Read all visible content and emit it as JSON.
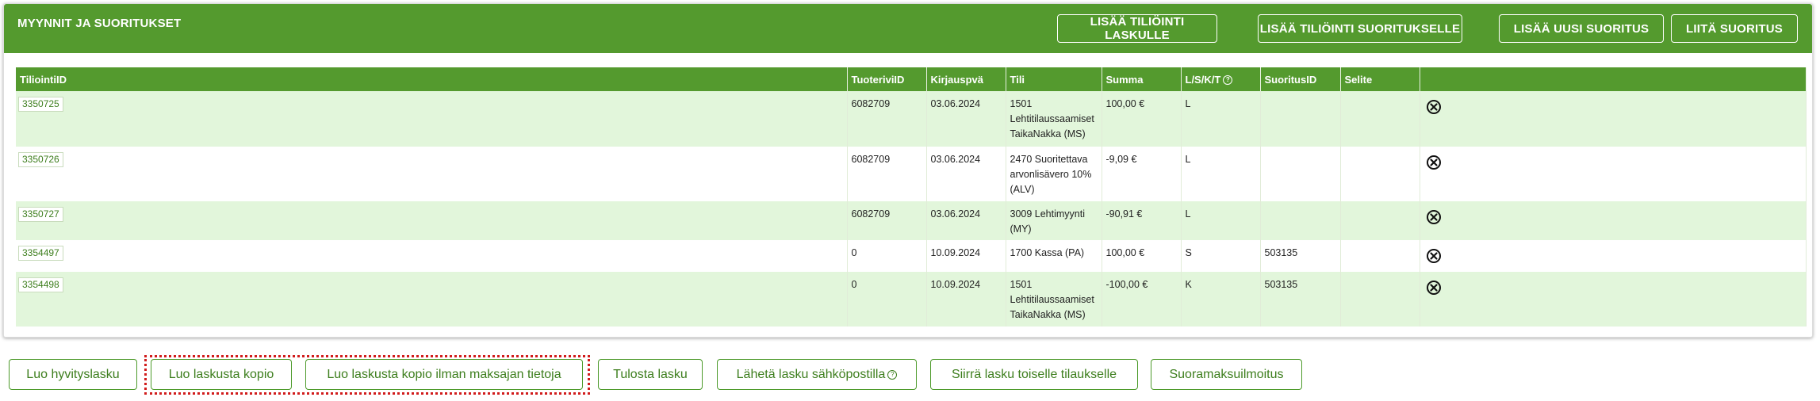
{
  "panel": {
    "title": "MYYNNIT JA SUORITUKSET",
    "buttons": [
      {
        "label": "LISÄÄ TILIÖINTI LASKULLE"
      },
      {
        "label": "LISÄÄ TILIÖINTI SUORITUKSELLE"
      },
      {
        "label": "LISÄÄ UUSI SUORITUS"
      },
      {
        "label": "LIITÄ SUORITUS"
      }
    ]
  },
  "table": {
    "columns": [
      "TiliointiID",
      "TuoteriviID",
      "Kirjauspvä",
      "Tili",
      "Summa",
      "L/S/K/T",
      "SuoritusID",
      "Selite",
      ""
    ],
    "rows": [
      {
        "id": "3350725",
        "tuoterivi": "6082709",
        "pvm": "03.06.2024",
        "tili": [
          "1501",
          "Lehtitilaussaamiset",
          "TaikaNakka (MS)"
        ],
        "summa": "100,00 €",
        "lskt": "L",
        "suoritus": "",
        "selite": ""
      },
      {
        "id": "3350726",
        "tuoterivi": "6082709",
        "pvm": "03.06.2024",
        "tili": [
          "2470 Suoritettava",
          "arvonlisävero 10%",
          "(ALV)"
        ],
        "summa": "-9,09 €",
        "lskt": "L",
        "suoritus": "",
        "selite": ""
      },
      {
        "id": "3350727",
        "tuoterivi": "6082709",
        "pvm": "03.06.2024",
        "tili": [
          "3009 Lehtimyynti",
          "(MY)"
        ],
        "summa": "-90,91 €",
        "lskt": "L",
        "suoritus": "",
        "selite": ""
      },
      {
        "id": "3354497",
        "tuoterivi": "0",
        "pvm": "10.09.2024",
        "tili": [
          "1700 Kassa (PA)"
        ],
        "summa": "100,00 €",
        "lskt": "S",
        "suoritus": "503135",
        "selite": ""
      },
      {
        "id": "3354498",
        "tuoterivi": "0",
        "pvm": "10.09.2024",
        "tili": [
          "1501",
          "Lehtitilaussaamiset",
          "TaikaNakka (MS)"
        ],
        "summa": "-100,00 €",
        "lskt": "K",
        "suoritus": "503135",
        "selite": ""
      }
    ],
    "help_icon": "question-circle-icon",
    "delete_icon": "circle-x-icon"
  },
  "bottom_buttons": [
    {
      "label": "Luo hyvityslasku"
    },
    {
      "label": "Luo laskusta kopio"
    },
    {
      "label": "Luo laskusta kopio ilman maksajan tietoja"
    },
    {
      "label": "Tulosta lasku"
    },
    {
      "label": "Lähetä lasku sähköpostilla"
    },
    {
      "label": "Siirrä lasku toiselle tilaukselle"
    },
    {
      "label": "Suoramaksuilmoitus"
    }
  ],
  "colors": {
    "accent": "#549a2e",
    "row_alt": "#e2f6db",
    "link": "#3d7e1d",
    "highlight": "#d11c1c"
  }
}
